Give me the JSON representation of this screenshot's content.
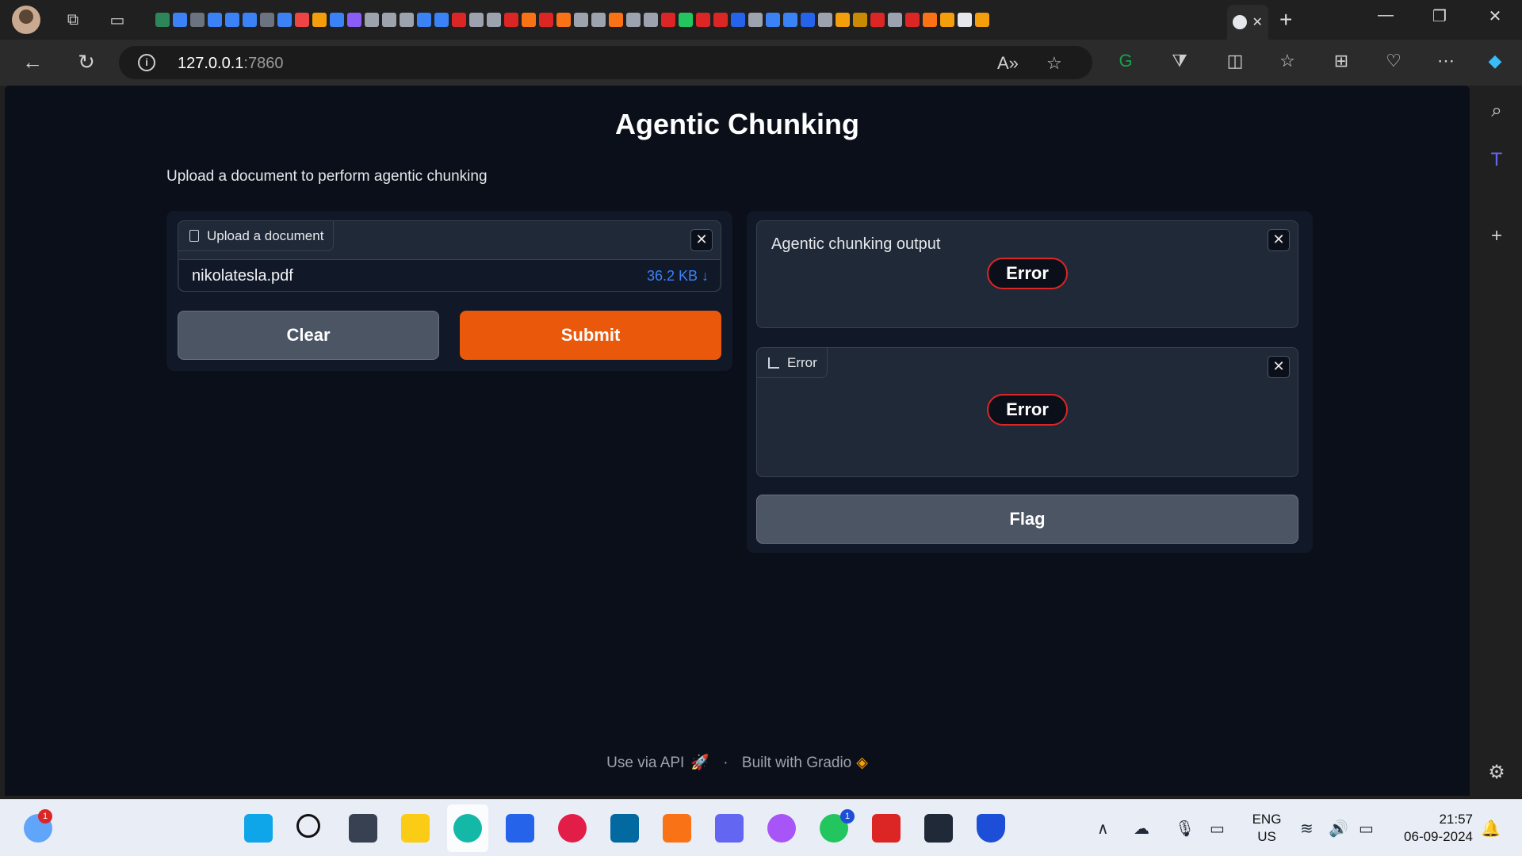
{
  "browser": {
    "url_host": "127.0.0.1",
    "url_port": ":7860"
  },
  "app": {
    "title": "Agentic Chunking",
    "description": "Upload a document to perform agentic chunking",
    "upload": {
      "label": "Upload a document",
      "file_name": "nikolatesla.pdf",
      "file_size": "36.2 KB ↓"
    },
    "buttons": {
      "clear": "Clear",
      "submit": "Submit",
      "flag": "Flag"
    },
    "output": {
      "label": "Agentic chunking output",
      "status": "Error"
    },
    "error_block": {
      "label": "Error",
      "status": "Error"
    },
    "footer": {
      "api": "Use via API",
      "separator": "·",
      "built": "Built with Gradio"
    }
  },
  "taskbar": {
    "weather_badge": "1",
    "whatsapp_badge": "1",
    "lang_top": "ENG",
    "lang_bottom": "US",
    "time": "21:57",
    "date": "06-09-2024"
  },
  "colors": {
    "accent": "#ea580c",
    "error": "#dc2626",
    "link": "#3b82f6",
    "page_bg": "#0b0f19"
  }
}
